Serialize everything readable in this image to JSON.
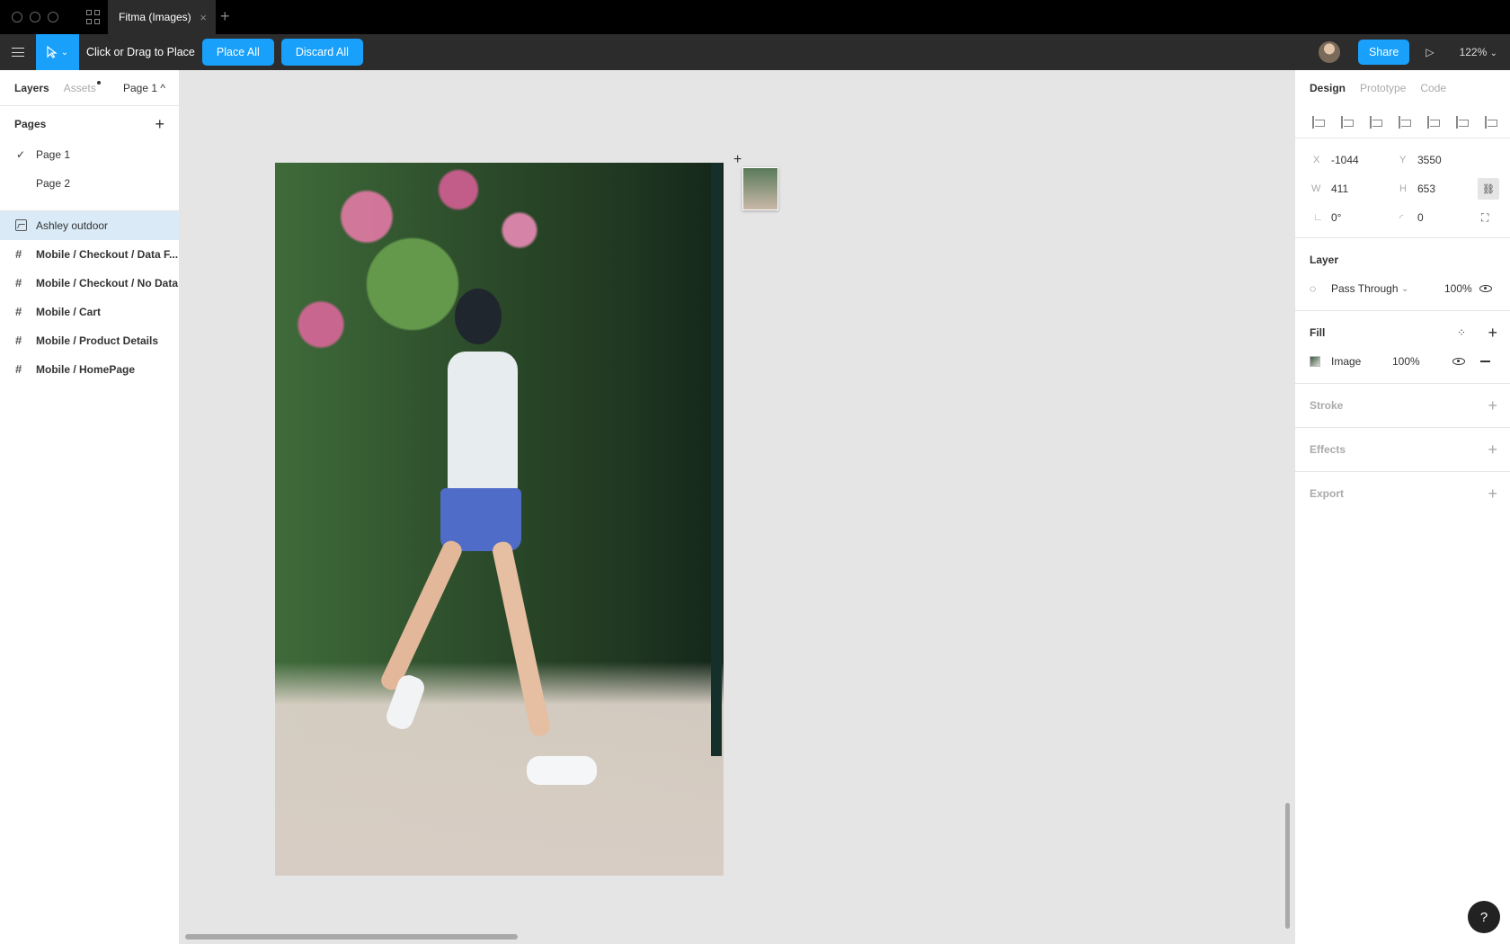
{
  "window": {
    "tab_title": "Fitma (Images)",
    "tab_close": "×",
    "new_tab": "+"
  },
  "toolbar": {
    "hint": "Click or Drag to Place",
    "place_all": "Place All",
    "discard_all": "Discard All",
    "share": "Share",
    "zoom": "122%",
    "zoom_caret": "⌄",
    "play": "▷",
    "move_caret": "⌄"
  },
  "left_panel": {
    "tabs": {
      "layers": "Layers",
      "assets": "Assets",
      "page_selector": "Page 1 ^"
    },
    "pages_header": "Pages",
    "add_page": "+",
    "pages": [
      {
        "label": "Page 1",
        "checked": "✓"
      },
      {
        "label": "Page 2"
      }
    ],
    "layers": [
      {
        "label": "Ashley outdoor",
        "type": "image"
      },
      {
        "label": "Mobile / Checkout / Data F...",
        "type": "frame"
      },
      {
        "label": "Mobile / Checkout / No Data",
        "type": "frame"
      },
      {
        "label": "Mobile / Cart",
        "type": "frame"
      },
      {
        "label": "Mobile / Product Details",
        "type": "frame"
      },
      {
        "label": "Mobile / HomePage",
        "type": "frame"
      }
    ],
    "frame_glyph": "#"
  },
  "right_panel": {
    "tabs": {
      "design": "Design",
      "prototype": "Prototype",
      "code": "Code"
    },
    "props": {
      "x_label": "X",
      "x_value": "-1044",
      "y_label": "Y",
      "y_value": "3550",
      "w_label": "W",
      "w_value": "411",
      "h_label": "H",
      "h_value": "653",
      "rotation_value": "0°",
      "radius_value": "0",
      "rotation_icon": "∟",
      "radius_icon": "◜",
      "lock_icon": "⛓",
      "resize_icon": "⛶"
    },
    "layer": {
      "title": "Layer",
      "blend_icon": "◌",
      "blend_mode": "Pass Through",
      "blend_caret": "⌄",
      "opacity": "100%"
    },
    "fill": {
      "title": "Fill",
      "styles_icon": "⁘",
      "add": "+",
      "type": "Image",
      "opacity": "100%"
    },
    "stroke": {
      "title": "Stroke",
      "add": "+"
    },
    "effects": {
      "title": "Effects",
      "add": "+"
    },
    "export": {
      "title": "Export",
      "add": "+"
    }
  },
  "canvas": {
    "cursor": "+"
  },
  "help": "?",
  "colors": {
    "accent": "#18a0fb",
    "toolbar_bg": "#2c2c2c",
    "titlebar_bg": "#000000",
    "canvas_bg": "#e5e5e5",
    "selected_layer": "#daebf7"
  }
}
